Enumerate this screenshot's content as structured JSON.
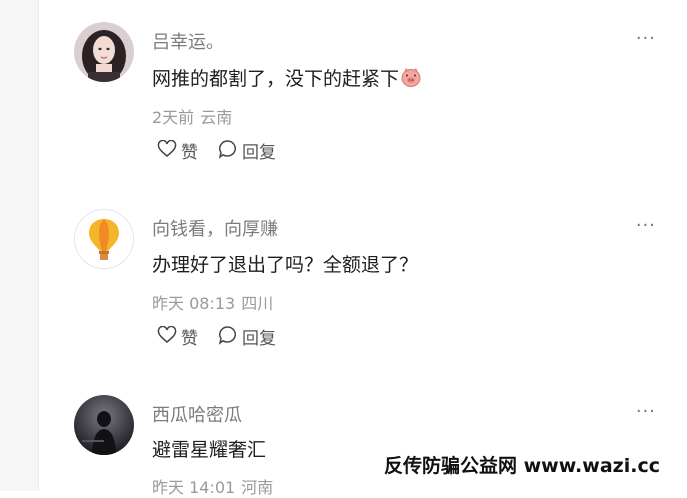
{
  "comments": [
    {
      "author": "吕幸运。",
      "text": "网推的都割了，没下的赶紧下",
      "emoji": "pig-face-emoji",
      "time": "2天前",
      "location": "云南",
      "like_label": "赞",
      "reply_label": "回复",
      "more_label": "···"
    },
    {
      "author": "向钱看，向厚赚",
      "text": "办理好了退出了吗？全额退了？",
      "time": "昨天 08:13",
      "location": "四川",
      "like_label": "赞",
      "reply_label": "回复",
      "more_label": "···"
    },
    {
      "author": "西瓜哈密瓜",
      "text": "避雷星耀奢汇",
      "time": "昨天 14:01",
      "location": "河南",
      "more_label": "···"
    }
  ],
  "watermark": "反传防骗公益网 www.wazi.cc",
  "colors": {
    "author": "#7c7c7c",
    "meta": "#9a9a9a",
    "balloon_yellow": "#f5b52a",
    "balloon_orange": "#f08a24"
  }
}
